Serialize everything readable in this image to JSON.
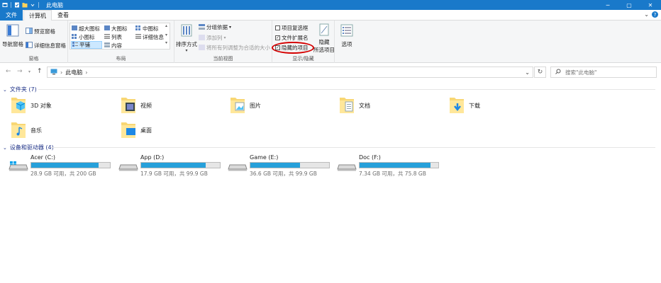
{
  "window": {
    "title": "此电脑",
    "controls": {
      "minimize": "─",
      "maximize": "▢",
      "close": "✕"
    }
  },
  "tabs": [
    {
      "label": "文件"
    },
    {
      "label": "计算机"
    },
    {
      "label": "查看"
    }
  ],
  "ribbon": {
    "pane_group": {
      "label": "窗格",
      "nav_pane": "导航窗格",
      "preview_pane": "预览窗格",
      "details_pane": "详细信息窗格"
    },
    "layout_group": {
      "label": "布局",
      "items": [
        "超大图标",
        "大图标",
        "中图标",
        "小图标",
        "列表",
        "详细信息",
        "平铺",
        "内容"
      ],
      "selected": "平铺"
    },
    "view_group": {
      "label": "当前视图",
      "sort_by": "排序方式",
      "group_by": "分组依据",
      "add_column": "添加列",
      "fit_columns": "将所有列调整为合适的大小"
    },
    "show_hide_group": {
      "label": "显示/隐藏",
      "item_checkboxes": {
        "label": "项目复选框",
        "checked": false
      },
      "file_extensions": {
        "label": "文件扩展名",
        "checked": true
      },
      "hidden_items": {
        "label": "隐藏的项目",
        "checked": true
      },
      "hide_selected": {
        "label_line1": "隐藏",
        "label_line2": "所选项目"
      }
    },
    "options": "选项"
  },
  "address": {
    "path": "此电脑",
    "search_placeholder": "搜索\"此电脑\""
  },
  "folders_section": {
    "title": "文件夹 (7)",
    "items": [
      {
        "name": "3D 对象",
        "icon": "3d-objects-folder-icon"
      },
      {
        "name": "视频",
        "icon": "videos-folder-icon"
      },
      {
        "name": "图片",
        "icon": "pictures-folder-icon"
      },
      {
        "name": "文档",
        "icon": "documents-folder-icon"
      },
      {
        "name": "下载",
        "icon": "downloads-folder-icon"
      },
      {
        "name": "音乐",
        "icon": "music-folder-icon"
      },
      {
        "name": "桌面",
        "icon": "desktop-folder-icon"
      }
    ]
  },
  "drives_section": {
    "title": "设备和驱动器 (4)",
    "items": [
      {
        "name": "Acer (C:)",
        "info": "28.9 GB 可用，共 200 GB",
        "used_fraction": 0.855
      },
      {
        "name": "App (D:)",
        "info": "17.9 GB 可用，共 99.9 GB",
        "used_fraction": 0.82
      },
      {
        "name": "Game (E:)",
        "info": "36.6 GB 可用，共 99.9 GB",
        "used_fraction": 0.63
      },
      {
        "name": "Doc (F:)",
        "info": "7.34 GB 可用，共 75.8 GB",
        "used_fraction": 0.9
      }
    ]
  },
  "colors": {
    "accent": "#1979ca",
    "drive_fill": "#26a0da",
    "highlight_circle": "#d40000"
  }
}
